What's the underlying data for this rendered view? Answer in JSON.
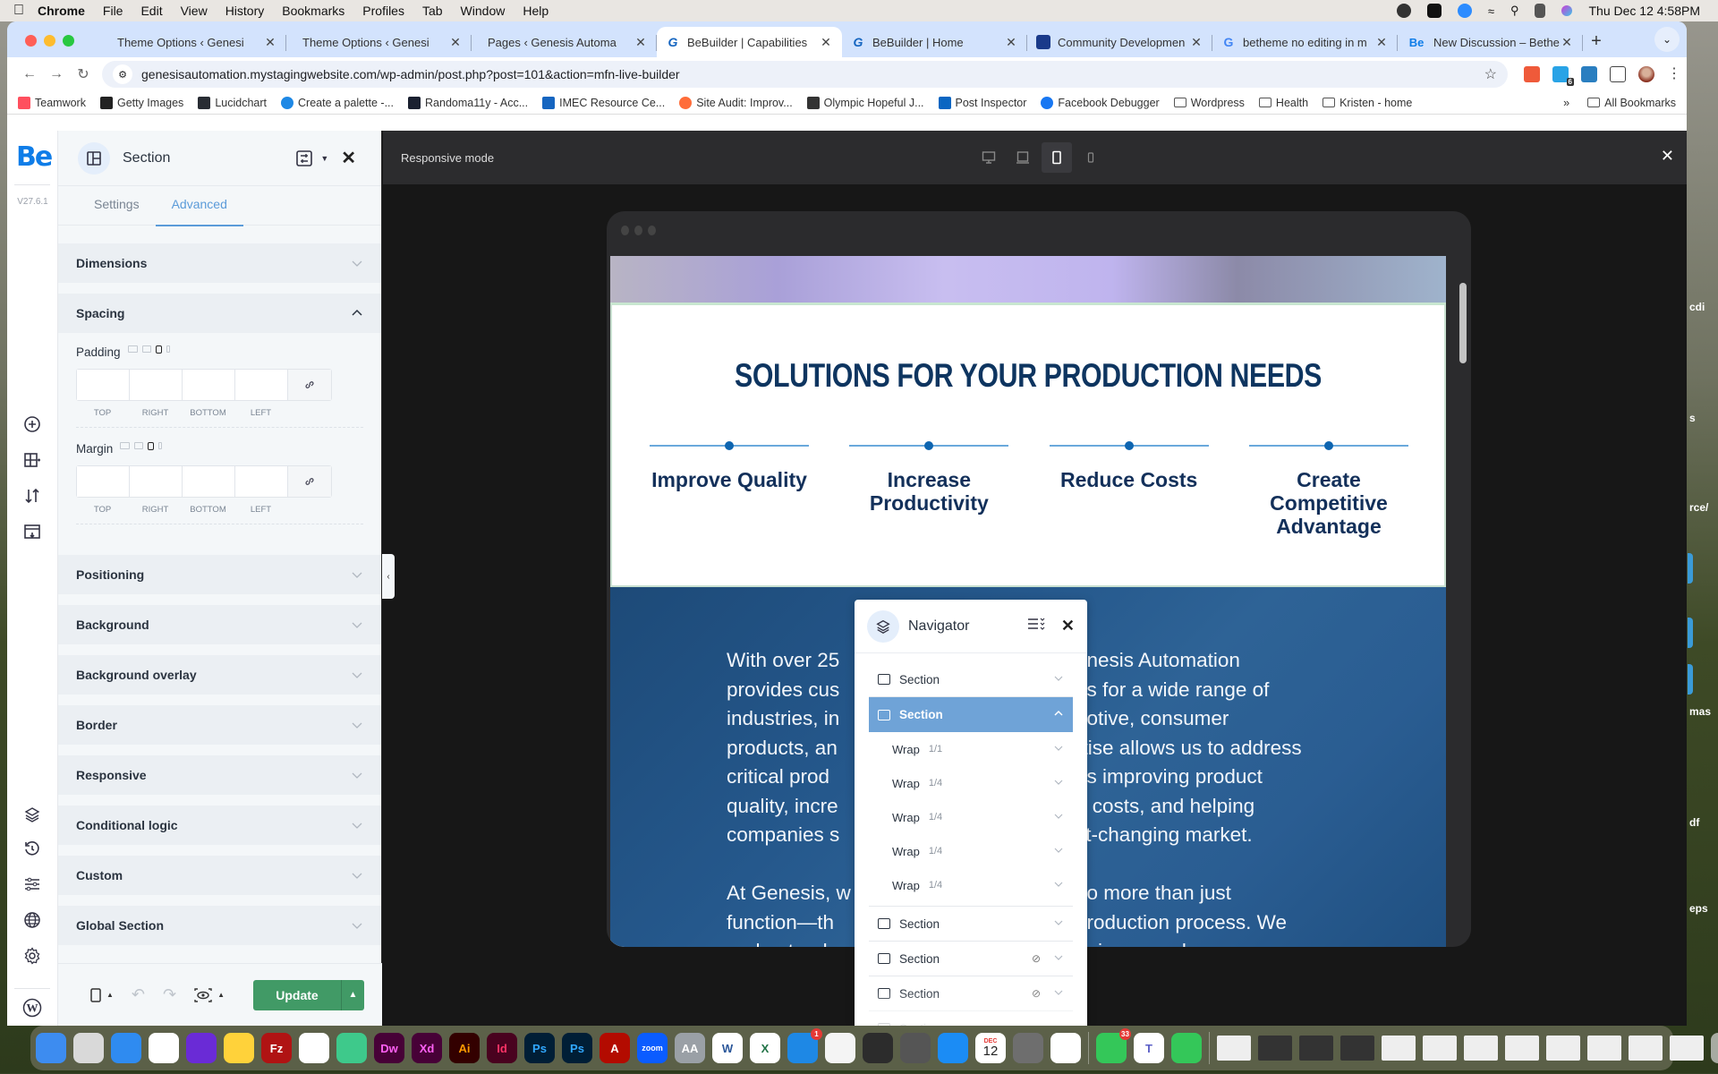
{
  "menubar": {
    "app": "Chrome",
    "items": [
      "File",
      "Edit",
      "View",
      "History",
      "Bookmarks",
      "Profiles",
      "Tab",
      "Window",
      "Help"
    ],
    "clock": "Thu Dec 12  4:58PM"
  },
  "tabs": [
    {
      "label": "Theme Options ‹ Genesi",
      "favicon": "wordpress-icon",
      "active": false
    },
    {
      "label": "Theme Options ‹ Genesi",
      "favicon": "wordpress-icon",
      "active": false
    },
    {
      "label": "Pages ‹ Genesis Automa",
      "favicon": "wordpress-icon",
      "active": false
    },
    {
      "label": "BeBuilder | Capabilities",
      "favicon": "genesis-icon",
      "active": true
    },
    {
      "label": "BeBuilder | Home",
      "favicon": "genesis-icon",
      "active": false
    },
    {
      "label": "Community Developmen",
      "favicon": "community-icon",
      "active": false
    },
    {
      "label": "betheme no editing in m",
      "favicon": "google-icon",
      "active": false
    },
    {
      "label": "New Discussion – Bethe",
      "favicon": "be-icon",
      "active": false
    }
  ],
  "address_bar": {
    "url": "genesisautomation.mystagingwebsite.com/wp-admin/post.php?post=101&action=mfn-live-builder"
  },
  "extensions": {
    "badge_count": "6"
  },
  "bookmarks": [
    {
      "label": "Teamwork",
      "color": "#ff4f5e"
    },
    {
      "label": "Getty Images",
      "color": "#222222"
    },
    {
      "label": "Lucidchart",
      "color": "#282c33"
    },
    {
      "label": "Create a palette -...",
      "color": "#1e88e5"
    },
    {
      "label": "Randoma11y - Acc...",
      "color": "#1a2030"
    },
    {
      "label": "IMEC Resource Ce...",
      "color": "#1565c0"
    },
    {
      "label": "Site Audit: Improv...",
      "color": "#ff6d3a"
    },
    {
      "label": "Olympic Hopeful J...",
      "color": "#333333"
    },
    {
      "label": "Post Inspector",
      "color": "#0a66c2"
    },
    {
      "label": "Facebook Debugger",
      "color": "#1877f2"
    },
    {
      "label": "Wordpress",
      "folder": true
    },
    {
      "label": "Health",
      "folder": true
    },
    {
      "label": "Kristen - home",
      "folder": true
    }
  ],
  "bookmarks_overflow": "»",
  "all_bookmarks": "All Bookmarks",
  "builder": {
    "logo": "Be",
    "version": "V27.6.1",
    "panel_title": "Section",
    "tabs": [
      "Settings",
      "Advanced"
    ],
    "active_tab": "Advanced",
    "accordions_top": [
      "Dimensions"
    ],
    "spacing": {
      "title": "Spacing",
      "padding_label": "Padding",
      "margin_label": "Margin",
      "sides": [
        "TOP",
        "RIGHT",
        "BOTTOM",
        "LEFT"
      ],
      "padding_values": [
        "",
        "",
        "",
        ""
      ],
      "margin_values": [
        "",
        "",
        "",
        ""
      ]
    },
    "accordions_bottom": [
      "Positioning",
      "Background",
      "Background overlay",
      "Border",
      "Responsive",
      "Conditional logic",
      "Custom",
      "Global Section"
    ],
    "update_label": "Update"
  },
  "responsive": {
    "title": "Responsive mode",
    "devices": [
      "desktop",
      "laptop",
      "tablet",
      "mobile"
    ],
    "active_device": "tablet"
  },
  "page": {
    "heading": "SOLUTIONS FOR YOUR PRODUCTION NEEDS",
    "features": [
      "Improve Quality",
      "Increase Productivity",
      "Reduce Costs",
      "Create Competitive Advantage"
    ],
    "para1_lines": [
      "With over 25",
      "provides cus",
      "industries, in",
      "products, an",
      "critical prod",
      "quality, incre",
      "companies s"
    ],
    "para1_right": [
      "enesis Automation",
      "ns for a wide range of",
      "notive, consumer",
      "rtise allows us to address",
      "as improving product",
      "e costs, and helping",
      "st-changing market."
    ],
    "para2_lines": [
      "At Genesis, w",
      "function—th",
      "understand"
    ],
    "para2_right": [
      "do more than just",
      "production process. We",
      "unique needs, so we"
    ]
  },
  "navigator": {
    "title": "Navigator",
    "items": [
      {
        "label": "Section",
        "type": "section",
        "hidden": false,
        "expanded": false,
        "selected": false
      },
      {
        "label": "Section",
        "type": "section",
        "hidden": false,
        "expanded": true,
        "selected": true,
        "children": [
          {
            "label": "Wrap",
            "size": "1/1"
          },
          {
            "label": "Wrap",
            "size": "1/4"
          },
          {
            "label": "Wrap",
            "size": "1/4"
          },
          {
            "label": "Wrap",
            "size": "1/4"
          },
          {
            "label": "Wrap",
            "size": "1/4"
          }
        ]
      },
      {
        "label": "Section",
        "type": "section",
        "hidden": false,
        "expanded": false,
        "selected": false
      },
      {
        "label": "Section",
        "type": "section",
        "hidden": true,
        "expanded": false,
        "selected": false
      },
      {
        "label": "Section",
        "type": "section",
        "hidden": true,
        "expanded": false,
        "selected": false
      },
      {
        "label": "Section",
        "type": "section",
        "hidden": false,
        "expanded": false,
        "selected": false
      }
    ]
  },
  "desktop_labels": [
    "cdi",
    "s",
    "rce/",
    "mas",
    "df",
    "eps"
  ],
  "dock": {
    "apps": [
      "Finder",
      "Launchpad",
      "Safari",
      "Chrome",
      "Firefox",
      "Cyberduck",
      "FileZilla",
      "VS Code",
      "Affinity",
      "Dw",
      "Xd",
      "Ai",
      "Id",
      "Ps",
      "Ps",
      "Acrobat",
      "zoom",
      "Font Book",
      "Word",
      "Excel",
      "Mail",
      "TextEdit",
      "QuickTime",
      "Calculator",
      "App Store",
      "Calendar",
      "System Settings",
      "Freeform",
      "Messages",
      "Teams",
      "FaceTime"
    ],
    "mail_badge": "1",
    "messages_badge": "33",
    "calendar_month": "DEC",
    "calendar_day": "12"
  },
  "colors": {
    "accent": "#5b9bd9",
    "update_green": "#419a66",
    "nav_selected": "#6fa3d7",
    "heading_navy": "#0e3560",
    "be_blue": "#0f7de8"
  }
}
